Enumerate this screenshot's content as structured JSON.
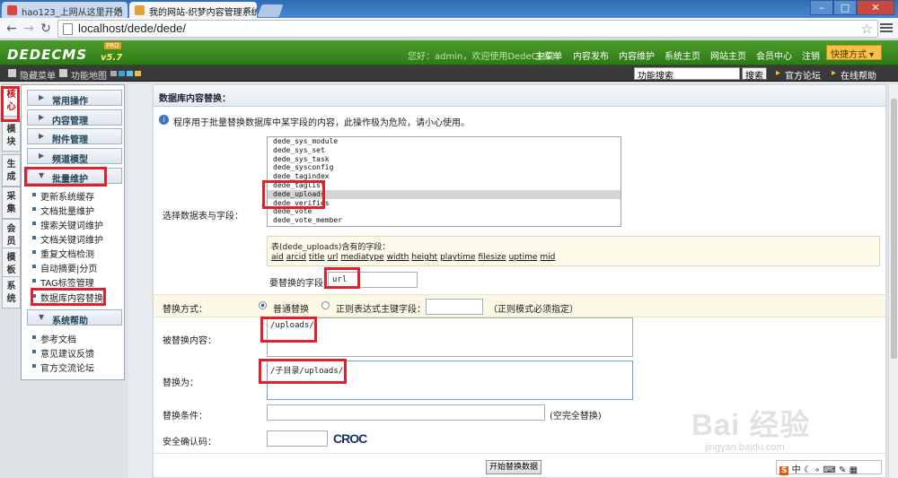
{
  "browser": {
    "tabs": [
      {
        "title": "hao123_上网从这里开始"
      },
      {
        "title": "我的网站-织梦内容管理系统"
      }
    ],
    "url": "localhost/dede/dede/"
  },
  "header": {
    "logo": "DEDECMS",
    "version": "v5.7",
    "badge": "PRO",
    "welcome": "您好：admin，欢迎使用DedeCMS！",
    "nav": [
      "主菜单",
      "内容发布",
      "内容维护",
      "系统主页",
      "网站主页",
      "会员中心",
      "注销"
    ],
    "quick": "快捷方式"
  },
  "subbar": {
    "hide_menu": "隐藏菜单",
    "func_map": "功能地图",
    "search_value": "功能搜索",
    "search_btn": "搜索",
    "forum": "官方论坛",
    "online_help": "在线帮助"
  },
  "vtabs": [
    "核心",
    "模块",
    "生成",
    "采集",
    "会员",
    "模板",
    "系统"
  ],
  "sidebar": {
    "groups": [
      "常用操作",
      "内容管理",
      "附件管理",
      "频道模型",
      "批量维护",
      "系统帮助"
    ],
    "batch_items": [
      "更新系统缓存",
      "文档批量维护",
      "搜索关键词维护",
      "文档关键词维护",
      "重复文档检测",
      "自动摘要|分页",
      "TAG标签管理",
      "数据库内容替换"
    ],
    "help_items": [
      "参考文档",
      "意见建议反馈",
      "官方交流论坛"
    ]
  },
  "main": {
    "title": "数据库内容替换：",
    "info": "程序用于批量替换数据库中某字段的内容，此操作极为危险，请小心使用。",
    "select_label": "选择数据表与字段：",
    "tables": [
      "dede_sys_module",
      "dede_sys_set",
      "dede_sys_task",
      "dede_sysconfig",
      "dede_tagindex",
      "dede_taglist",
      "dede_uploads",
      "dede_verifies",
      "dede_vote",
      "dede_vote_member"
    ],
    "selected_table": "dede_uploads",
    "fields_title": "表(dede_uploads)含有的字段：",
    "fields": [
      "aid",
      "arcid",
      "title",
      "url",
      "mediatype",
      "width",
      "height",
      "playtime",
      "filesize",
      "uptime",
      "mid"
    ],
    "field_label": "要替换的字段：",
    "field_value": "url",
    "mode_label": "替换方式：",
    "mode_normal": "普通替换",
    "mode_regex": "正则表达式",
    "pk_label": "主键字段：",
    "regex_note": "（正则模式必须指定）",
    "from_label": "被替换内容：",
    "from_value": "/uploads/",
    "to_label": "替换为：",
    "to_value": "/子目录/uploads/",
    "cond_label": "替换条件：",
    "cond_note": "(空完全替换)",
    "captcha_label": "安全确认码：",
    "captcha_text": "CROC",
    "submit": "开始替换数据"
  },
  "watermark": {
    "brand": "Bai 经验",
    "url": "jingyan.baidu.com"
  },
  "ime": {
    "label": "中"
  }
}
